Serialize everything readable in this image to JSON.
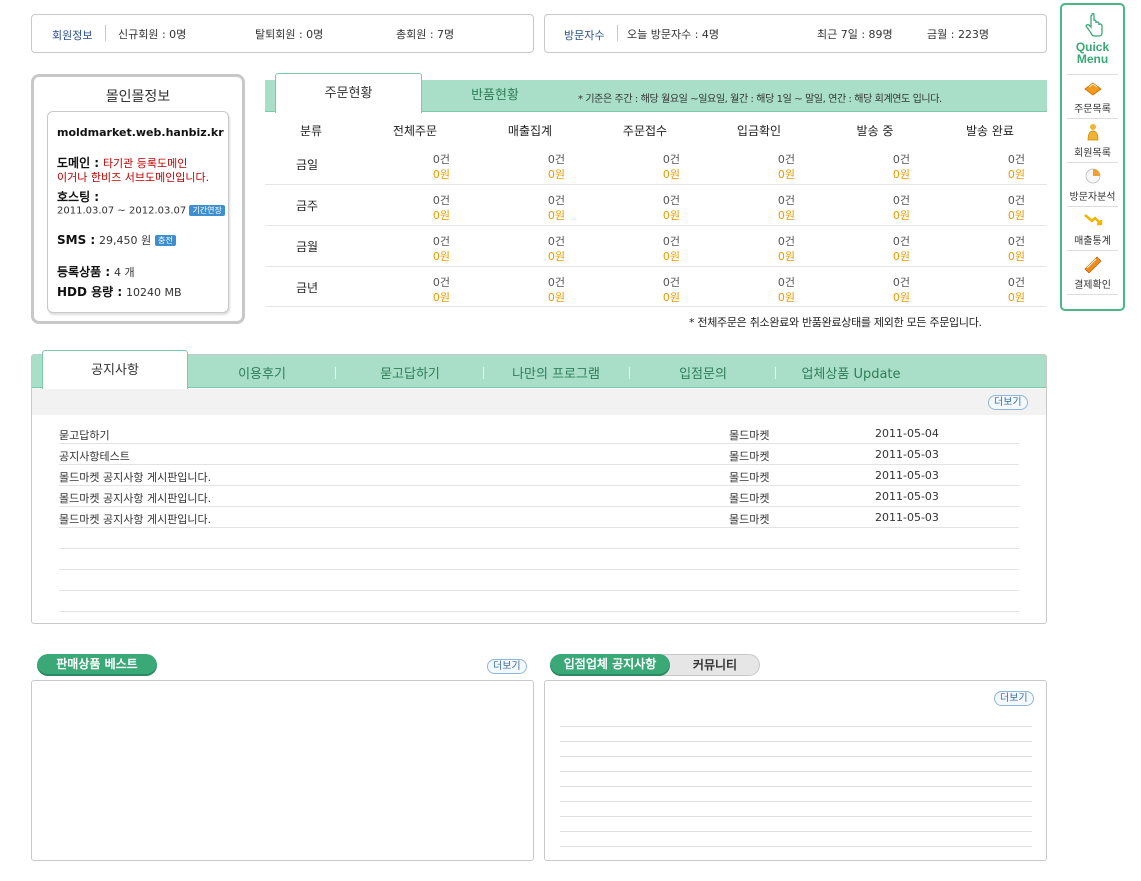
{
  "member_bar": {
    "label": "회원정보",
    "new": "신규회원 : 0명",
    "left": "탈퇴회원 : 0명",
    "total": "총회원 : 7명"
  },
  "visit_bar": {
    "label": "방문자수",
    "today": "오늘 방문자수 : 4명",
    "week": "최근 7일 : 89명",
    "month": "금월 : 223명"
  },
  "mall_info": {
    "title": "몰인몰정보",
    "domain_url": "moldmarket.web.hanbiz.kr",
    "domain_label": "도메인 :",
    "domain_note1": "타기관 등록도메인",
    "domain_note2": "이거나 한비즈 서브도메인입니다.",
    "hosting_label": "호스팅 :",
    "hosting_period": "2011.03.07 ~ 2012.03.07",
    "hosting_badge": "기간연장",
    "sms_label": "SMS :",
    "sms_value": "29,450 원",
    "sms_badge": "충전",
    "products_label": "등록상품 :",
    "products_value": "4 개",
    "hdd_label": "HDD 용량 :",
    "hdd_value": "10240 MB"
  },
  "order_tabs": {
    "active": "주문현황",
    "other": "반품현황",
    "note": "* 기준은 주간 : 해당 월요일 ~일요일, 월간 : 해당 1일 ~ 말일, 연간 : 해당 회계연도 입니다."
  },
  "order_table": {
    "headers": [
      "분류",
      "전체주문",
      "매출집계",
      "주문접수",
      "입금확인",
      "발송 중",
      "발송 완료"
    ],
    "rows": [
      {
        "label": "금일",
        "count": "0건",
        "amount": "0원"
      },
      {
        "label": "금주",
        "count": "0건",
        "amount": "0원"
      },
      {
        "label": "금월",
        "count": "0건",
        "amount": "0원"
      },
      {
        "label": "금년",
        "count": "0건",
        "amount": "0원"
      }
    ],
    "footnote": "* 전체주문은 취소완료와 반품완료상태를 제외한 모든 주문입니다."
  },
  "notice_tabs": [
    "공지사항",
    "이용후기",
    "묻고답하기",
    "나만의 프로그램",
    "입점문의",
    "업체상품 Update"
  ],
  "more_label": "더보기",
  "notices": [
    {
      "title": "묻고답하기",
      "author": "몰드마켓",
      "date": "2011-05-04"
    },
    {
      "title": "공지사항테스트",
      "author": "몰드마켓",
      "date": "2011-05-03"
    },
    {
      "title": "몰드마켓 공지사항 게시판입니다.",
      "author": "몰드마켓",
      "date": "2011-05-03"
    },
    {
      "title": "몰드마켓 공지사항 게시판입니다.",
      "author": "몰드마켓",
      "date": "2011-05-03"
    },
    {
      "title": "몰드마켓 공지사항 게시판입니다.",
      "author": "몰드마켓",
      "date": "2011-05-03"
    }
  ],
  "best_products": {
    "title": "판매상품 베스트"
  },
  "vendor_tabs": {
    "active": "입점업체 공지사항",
    "other": "커뮤니티"
  },
  "quick_menu": {
    "title1": "Quick",
    "title2": "Menu",
    "items": [
      {
        "label": "주문목록",
        "icon": "order-list-icon",
        "color": "#f39a1e"
      },
      {
        "label": "회원목록",
        "icon": "member-list-icon",
        "color": "#f2b233"
      },
      {
        "label": "방문자분석",
        "icon": "visitor-analysis-icon",
        "color": "#f0a030"
      },
      {
        "label": "매출통계",
        "icon": "sales-stats-icon",
        "color": "#f4b400"
      },
      {
        "label": "결제확인",
        "icon": "payment-check-icon",
        "color": "#f08a1c"
      }
    ]
  }
}
